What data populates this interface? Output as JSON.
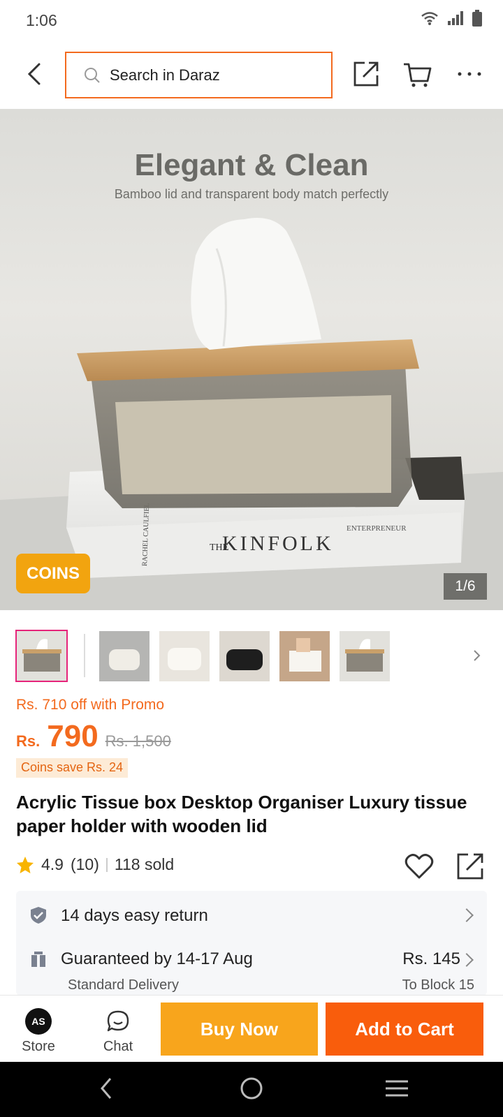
{
  "status": {
    "time": "1:06"
  },
  "search": {
    "placeholder": "Search in Daraz"
  },
  "hero": {
    "headline": "Elegant & Clean",
    "subline": "Bamboo lid and transparent body match perfectly",
    "badge": "COINS",
    "counter": "1/6",
    "book_title": "KINFOLK",
    "book_the": "THE",
    "book_right": "ENTERPRENEUR",
    "book_spine": "RACHEL CAULFIEL",
    "colors": {
      "badge": "#f2a40f"
    }
  },
  "thumbnails": [
    "tissue-box-front",
    "white-wave-box",
    "white-wave-box-2",
    "black-wave-box",
    "tissue-box-hand",
    "tissue-box-front-2"
  ],
  "price": {
    "promo": "Rs. 710 off with Promo",
    "currency": "Rs.",
    "amount": "790",
    "original": "Rs. 1,500",
    "coins_save": "Coins save Rs. 24",
    "accent": "#f36a1e"
  },
  "product": {
    "title": "Acrylic Tissue box Desktop Organiser Luxury tissue paper holder with wooden lid",
    "rating": "4.9",
    "reviews": "(10)",
    "sold": "118 sold"
  },
  "info": {
    "return_label": "14 days easy return",
    "delivery_label": "Guaranteed by 14-17 Aug",
    "delivery_type": "Standard Delivery",
    "delivery_price": "Rs. 145",
    "delivery_to": "To Block 15"
  },
  "bottom": {
    "store_label": "Store",
    "store_logo_text": "AS",
    "chat_label": "Chat",
    "buy_now": "Buy Now",
    "add_to_cart": "Add to Cart",
    "buy_color": "#f8a51c",
    "cart_color": "#f95d0c"
  }
}
